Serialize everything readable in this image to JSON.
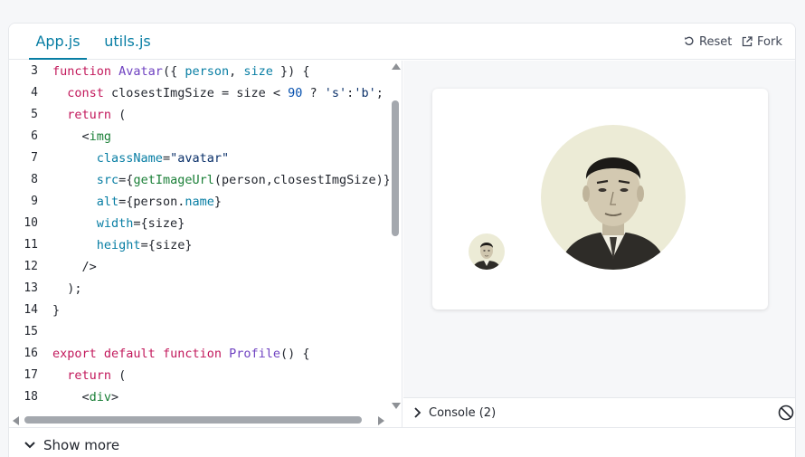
{
  "tabs": [
    {
      "label": "App.js",
      "active": true
    },
    {
      "label": "utils.js",
      "active": false
    }
  ],
  "actions": {
    "reset_label": "Reset",
    "fork_label": "Fork"
  },
  "code": {
    "lines": [
      {
        "n": "3",
        "tokens": [
          {
            "t": "function ",
            "c": "kw"
          },
          {
            "t": "Avatar",
            "c": "fn"
          },
          {
            "t": "({ ",
            "c": ""
          },
          {
            "t": "person",
            "c": "pr"
          },
          {
            "t": ", ",
            "c": ""
          },
          {
            "t": "size",
            "c": "pr"
          },
          {
            "t": " }) {",
            "c": ""
          }
        ]
      },
      {
        "n": "4",
        "tokens": [
          {
            "t": "  ",
            "c": ""
          },
          {
            "t": "const ",
            "c": "kw"
          },
          {
            "t": "closestImgSize = size < ",
            "c": ""
          },
          {
            "t": "90",
            "c": "nu"
          },
          {
            "t": " ? ",
            "c": ""
          },
          {
            "t": "'s'",
            "c": "st"
          },
          {
            "t": ":",
            "c": ""
          },
          {
            "t": "'b'",
            "c": "st"
          },
          {
            "t": ";",
            "c": ""
          }
        ]
      },
      {
        "n": "5",
        "tokens": [
          {
            "t": "  ",
            "c": ""
          },
          {
            "t": "return",
            "c": "kw"
          },
          {
            "t": " (",
            "c": ""
          }
        ]
      },
      {
        "n": "6",
        "tokens": [
          {
            "t": "    <",
            "c": ""
          },
          {
            "t": "img",
            "c": "tg"
          }
        ]
      },
      {
        "n": "7",
        "tokens": [
          {
            "t": "      ",
            "c": ""
          },
          {
            "t": "className",
            "c": "pr"
          },
          {
            "t": "=",
            "c": ""
          },
          {
            "t": "\"avatar\"",
            "c": "st"
          }
        ]
      },
      {
        "n": "8",
        "tokens": [
          {
            "t": "      ",
            "c": ""
          },
          {
            "t": "src",
            "c": "pr"
          },
          {
            "t": "={",
            "c": ""
          },
          {
            "t": "getImageUrl",
            "c": "tg"
          },
          {
            "t": "(person,closestImgSize)}",
            "c": ""
          }
        ]
      },
      {
        "n": "9",
        "tokens": [
          {
            "t": "      ",
            "c": ""
          },
          {
            "t": "alt",
            "c": "pr"
          },
          {
            "t": "={person.",
            "c": ""
          },
          {
            "t": "name",
            "c": "pr"
          },
          {
            "t": "}",
            "c": ""
          }
        ]
      },
      {
        "n": "10",
        "tokens": [
          {
            "t": "      ",
            "c": ""
          },
          {
            "t": "width",
            "c": "pr"
          },
          {
            "t": "={size}",
            "c": ""
          }
        ]
      },
      {
        "n": "11",
        "tokens": [
          {
            "t": "      ",
            "c": ""
          },
          {
            "t": "height",
            "c": "pr"
          },
          {
            "t": "={size}",
            "c": ""
          }
        ]
      },
      {
        "n": "12",
        "tokens": [
          {
            "t": "    />",
            "c": ""
          }
        ]
      },
      {
        "n": "13",
        "tokens": [
          {
            "t": "  );",
            "c": ""
          }
        ]
      },
      {
        "n": "14",
        "tokens": [
          {
            "t": "}",
            "c": ""
          }
        ]
      },
      {
        "n": "15",
        "tokens": []
      },
      {
        "n": "16",
        "tokens": [
          {
            "t": "export ",
            "c": "kw"
          },
          {
            "t": "default ",
            "c": "kw"
          },
          {
            "t": "function ",
            "c": "kw"
          },
          {
            "t": "Profile",
            "c": "fn"
          },
          {
            "t": "() {",
            "c": ""
          }
        ]
      },
      {
        "n": "17",
        "tokens": [
          {
            "t": "  ",
            "c": ""
          },
          {
            "t": "return",
            "c": "kw"
          },
          {
            "t": " (",
            "c": ""
          }
        ]
      },
      {
        "n": "18",
        "tokens": [
          {
            "t": "    <",
            "c": ""
          },
          {
            "t": "div",
            "c": "tg"
          },
          {
            "t": ">",
            "c": ""
          }
        ]
      }
    ]
  },
  "console": {
    "label": "Console (2)"
  },
  "footer": {
    "show_more_label": "Show more"
  },
  "colors": {
    "accent": "#087ea4",
    "keyword": "#c2185b",
    "function": "#6f42c1",
    "tag": "#1a7f37",
    "string": "#0a3069"
  }
}
